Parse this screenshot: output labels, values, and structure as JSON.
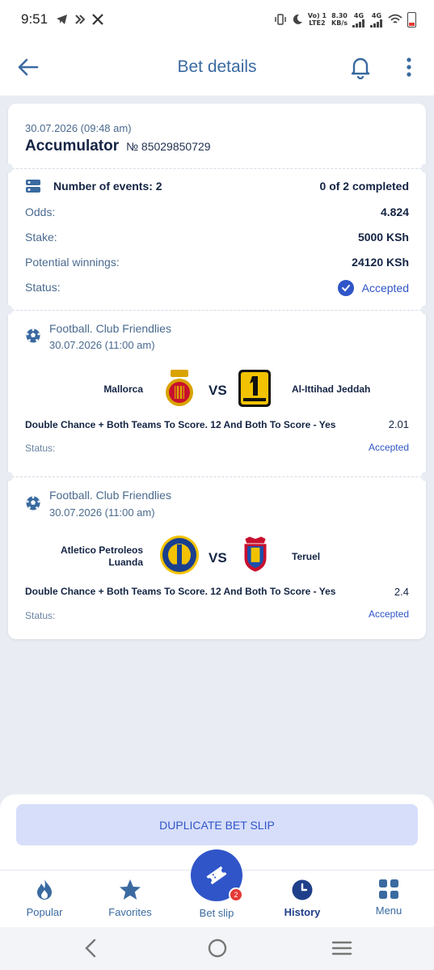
{
  "status_bar": {
    "time": "9:51",
    "left_icons": [
      "telegram-icon",
      "arrows-icon",
      "x-icon"
    ],
    "right_small_1": [
      "Vo) 1",
      "LTE2"
    ],
    "right_small_2": [
      "8.30",
      "KB/s"
    ],
    "net_1": "4G",
    "net_2": "4G"
  },
  "header": {
    "title": "Bet details"
  },
  "summary": {
    "datetime": "30.07.2026 (09:48 am)",
    "type": "Accumulator",
    "number": "№ 85029850729",
    "events_label": "Number of events: 2",
    "events_completed": "0 of 2 completed",
    "odds_label": "Odds:",
    "odds_value": "4.824",
    "stake_label": "Stake:",
    "stake_value": "5000 KSh",
    "winnings_label": "Potential winnings:",
    "winnings_value": "24120 KSh",
    "status_label": "Status:",
    "status_value": "Accepted"
  },
  "events": [
    {
      "league": "Football. Club Friendlies",
      "datetime": "30.07.2026 (11:00 am)",
      "home": "Mallorca",
      "away": "Al-Ittihad Jeddah",
      "vs": "VS",
      "market": "Double Chance + Both Teams To Score. 12 And Both To Score - Yes",
      "odd": "2.01",
      "status_label": "Status:",
      "status_value": "Accepted"
    },
    {
      "league": "Football. Club Friendlies",
      "datetime": "30.07.2026 (11:00 am)",
      "home_line1": "Atletico Petroleos",
      "home_line2": "Luanda",
      "away": "Teruel",
      "vs": "VS",
      "market": "Double Chance + Both Teams To Score. 12 And Both To Score - Yes",
      "odd": "2.4",
      "status_label": "Status:",
      "status_value": "Accepted"
    }
  ],
  "actions": {
    "duplicate": "DUPLICATE BET SLIP"
  },
  "bottom_nav": {
    "popular": "Popular",
    "favorites": "Favorites",
    "betslip": "Bet slip",
    "betslip_count": "2",
    "history": "History",
    "menu": "Menu"
  },
  "colors": {
    "accent": "#2f55c8",
    "title": "#3a6aa0",
    "background": "#e9edf3"
  }
}
